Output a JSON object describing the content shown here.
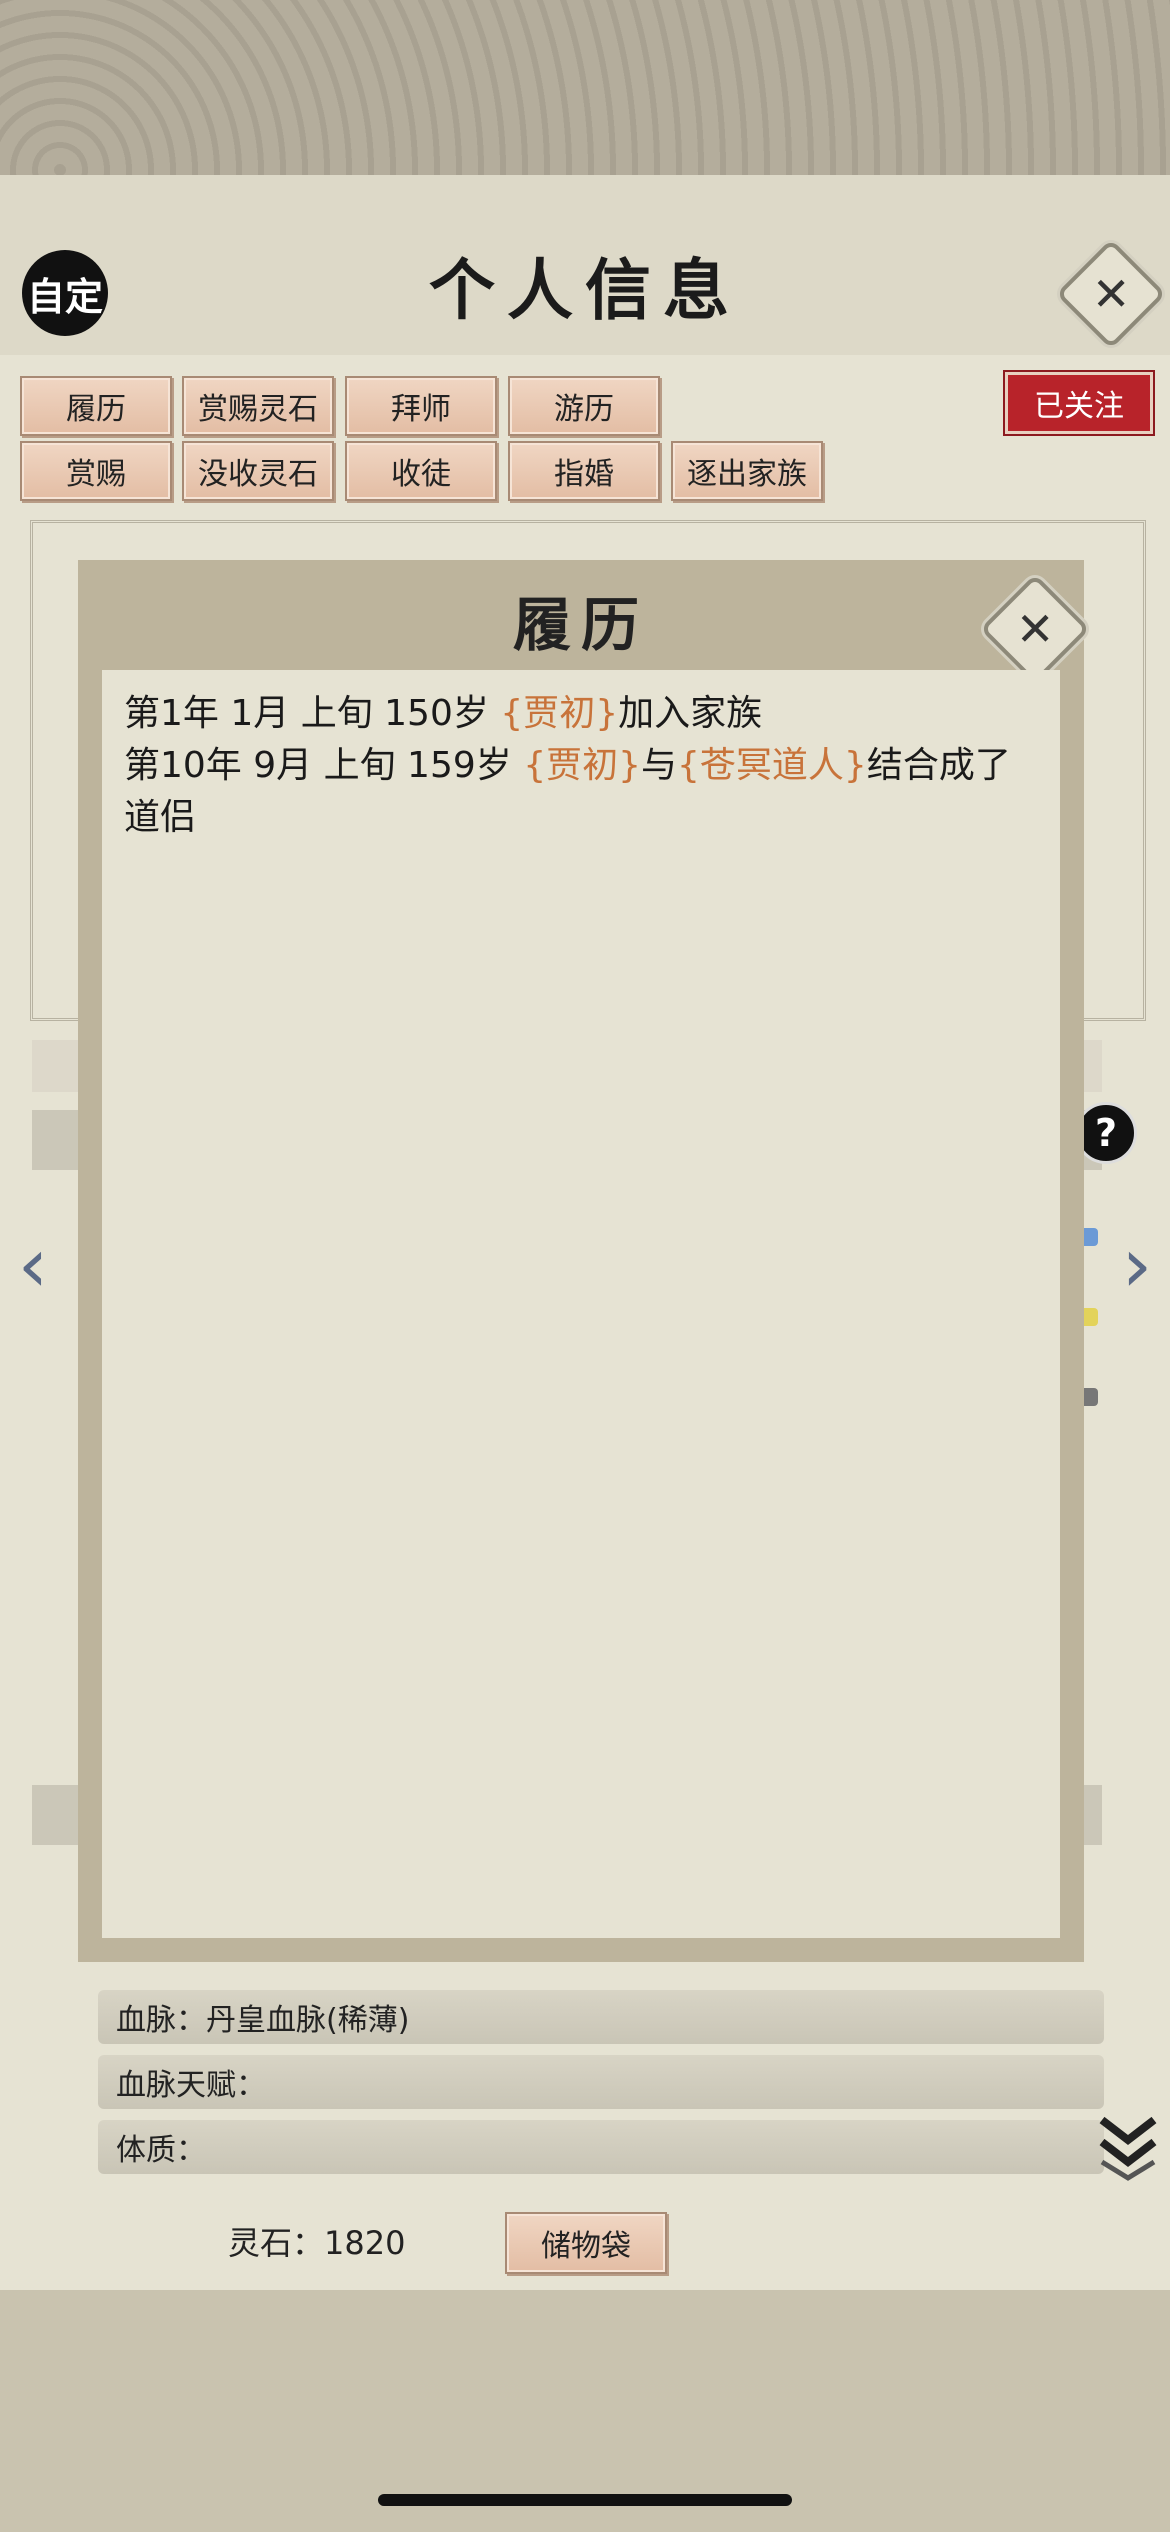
{
  "header": {
    "custom_label": "自定",
    "title": "个人信息",
    "close_icon": "close-icon"
  },
  "actions": {
    "row1": [
      "履历",
      "赏赐灵石",
      "拜师",
      "游历"
    ],
    "row2": [
      "赏赐",
      "没收灵石",
      "收徒",
      "指婚",
      "逐出家族"
    ],
    "followed": "已关注"
  },
  "background_rows": {
    "bloodline": "血脉：丹皇血脉(稀薄)",
    "bloodline_talent": "血脉天赋：",
    "physique": "体质："
  },
  "footer": {
    "spirit_stones": "灵石：1820",
    "storage_bag": "储物袋"
  },
  "modal": {
    "title": "履历",
    "entries": [
      {
        "date": "第1年 1月 上旬  150岁 ",
        "char1": "{贾初}",
        "text": "加入家族"
      },
      {
        "date": "第10年 9月 上旬 159岁 ",
        "char1": "{贾初}",
        "mid": "与",
        "char2": "{苍冥道人}",
        "text": "结合成了道侣"
      }
    ]
  },
  "colors": {
    "character_name": "#c8733a",
    "followed_badge": "#b8232a",
    "button_fill": "#e8c8b0"
  }
}
